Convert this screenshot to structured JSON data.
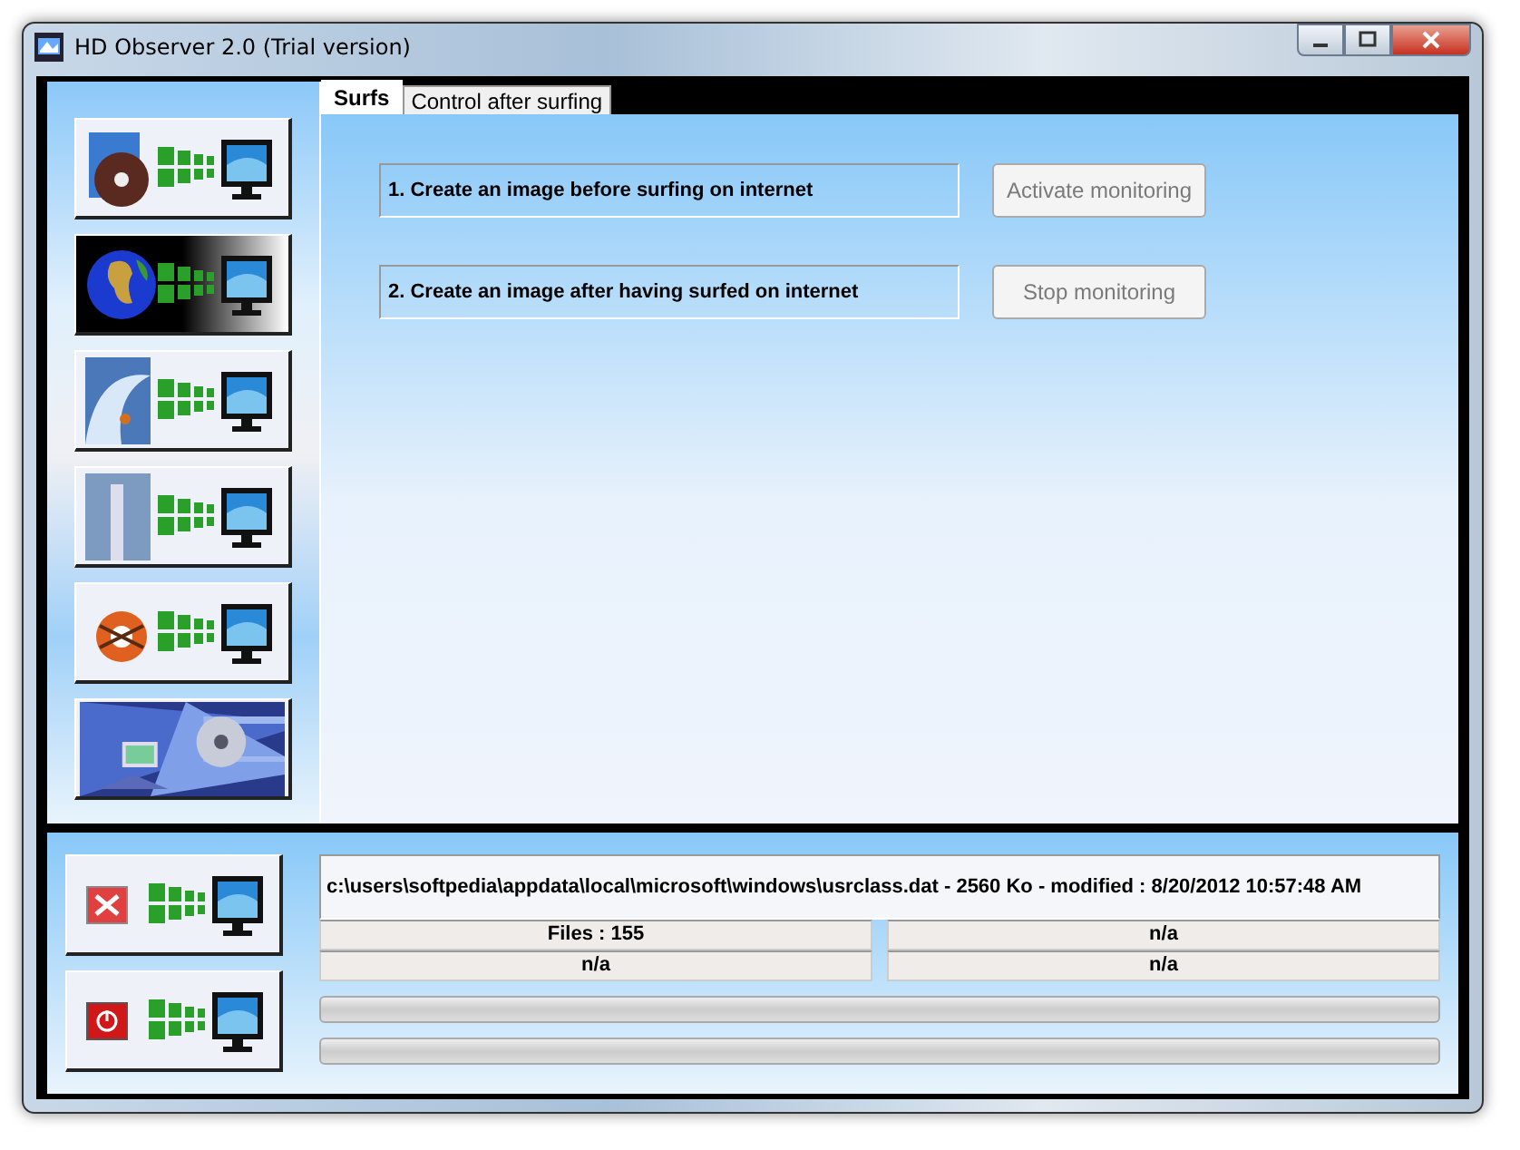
{
  "window": {
    "title": "HD Observer 2.0 (Trial version)"
  },
  "sidebar": {
    "buttons": [
      {
        "kind": "disc"
      },
      {
        "kind": "globe"
      },
      {
        "kind": "wave"
      },
      {
        "kind": "tower"
      },
      {
        "kind": "fan"
      },
      {
        "kind": "splash"
      }
    ]
  },
  "tabs": [
    {
      "label": "Surfs",
      "selected": true
    },
    {
      "label": "Control after surfing",
      "selected": false
    }
  ],
  "steps": [
    {
      "label": "1. Create an image before surfing on internet",
      "button": "Activate monitoring",
      "disabled": true
    },
    {
      "label": "2. Create an image after having surfed on internet",
      "button": "Stop monitoring",
      "disabled": true
    }
  ],
  "bottom_buttons": [
    {
      "kind": "stop"
    },
    {
      "kind": "power"
    }
  ],
  "status": {
    "file": "c:\\users\\softpedia\\appdata\\local\\microsoft\\windows\\usrclass.dat - 2560 Ko - modified : 8/20/2012 10:57:48 AM",
    "cells": [
      "Files : 155",
      "n/a",
      "n/a",
      "n/a"
    ]
  },
  "progress": [
    {
      "level": 0
    },
    {
      "level": 0
    }
  ]
}
